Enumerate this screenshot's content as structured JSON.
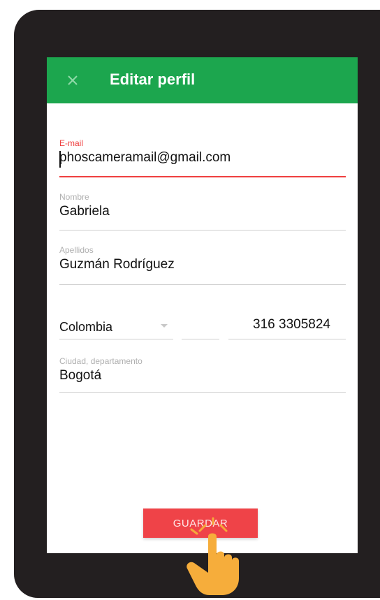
{
  "appbar": {
    "title": "Editar perfil",
    "close_icon": "close-icon",
    "color": "#1ca64e"
  },
  "form": {
    "email": {
      "label": "E-mail",
      "value": "phoscameramail@gmail.com"
    },
    "nombre": {
      "label": "Nombre",
      "value": "Gabriela"
    },
    "apellidos": {
      "label": "Apellidos",
      "value": "Guzmán Rodríguez"
    },
    "country": {
      "value": "Colombia"
    },
    "phone_prefix": {
      "value": ""
    },
    "phone": {
      "value": "316  3305824"
    },
    "ciudad": {
      "label": "Ciudad, departamento",
      "value": "Bogotá"
    }
  },
  "actions": {
    "save_label": "GUARDAR",
    "accent": "#ef4348"
  },
  "overlay": {
    "pointer_icon": "tap-hand-icon"
  }
}
